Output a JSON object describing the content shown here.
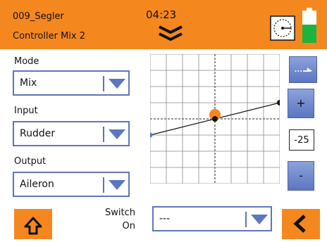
{
  "header": {
    "model_name": "009_Segler",
    "screen_title": "Controller Mix 2",
    "clock": "04:23",
    "accent_color": "#F4881E",
    "battery_color": "#1CB43C"
  },
  "mode": {
    "label": "Mode",
    "value": "Mix"
  },
  "input": {
    "label": "Input",
    "value": "Rudder"
  },
  "output": {
    "label": "Output",
    "value": "Aileron"
  },
  "switch": {
    "label_line1": "Switch",
    "label_line2": "On",
    "value": "---"
  },
  "controls": {
    "plus_label": "+",
    "minus_label": "-",
    "value": "-25"
  },
  "curve_data": {
    "x_range": [
      -100,
      100
    ],
    "y_range": [
      -100,
      100
    ],
    "points": [
      [
        -100,
        -25
      ],
      [
        100,
        25
      ]
    ],
    "current": [
      0,
      0
    ],
    "grid_divisions": 8
  },
  "icons": {
    "chevron": "double-chevron-down-icon",
    "sensor": "telemetry-icon",
    "battery": "battery-icon",
    "home": "home-icon",
    "back": "back-arrow-icon",
    "mode_toggle": "airplane-icon",
    "dropdown": "triangle-down-icon"
  }
}
